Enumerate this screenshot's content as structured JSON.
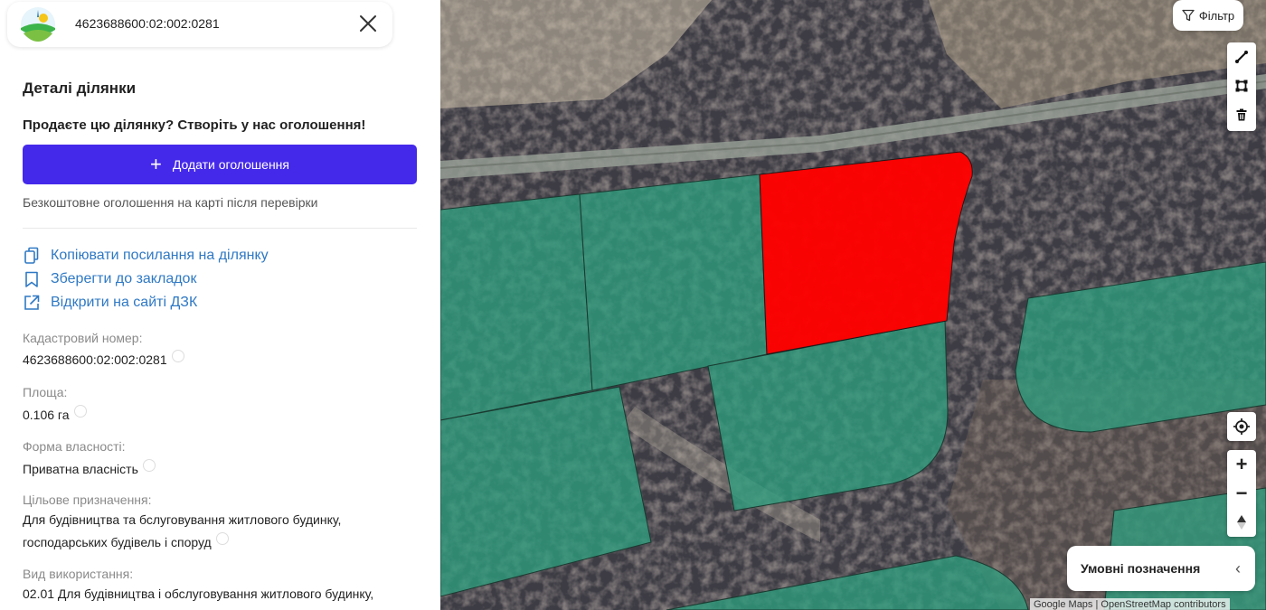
{
  "header": {
    "cadastral_title": "4623688600:02:002:0281",
    "close_icon": "close-icon",
    "logo_icon": "app-logo-icon"
  },
  "details": {
    "section_title": "Деталі ділянки",
    "promo_text": "Продаєте цю ділянку? Створіть у нас оголошення!",
    "add_button_label": "Додати оголошення",
    "add_button_color": "#4529ea",
    "free_note": "Безкоштовне оголошення на карті після перевірки"
  },
  "links": [
    {
      "label": "Копіювати посилання на ділянку",
      "icon": "copy-icon"
    },
    {
      "label": "Зберегти до закладок",
      "icon": "bookmark-icon"
    },
    {
      "label": "Відкрити на сайті ДЗК",
      "icon": "external-link-icon"
    }
  ],
  "fields": [
    {
      "label": "Кадастровий номер:",
      "value": "4623688600:02:002:0281"
    },
    {
      "label": "Площа:",
      "value": "0.106 га"
    },
    {
      "label": "Форма власності:",
      "value": "Приватна власність"
    },
    {
      "label": "Цільове призначення:",
      "value_line1": "Для будівництва та бслуговування житлового будинку,",
      "value_line2": "господарських будівель і споруд"
    },
    {
      "label": "Вид використання:",
      "value": "02.01 Для будівництва і обслуговування житлового будинку,"
    }
  ],
  "map": {
    "filter_label": "Фільтр",
    "legend_label": "Умовні позначення",
    "attribution": "Google Maps | OpenStreetMap contributors",
    "selected_parcel_color": "#ff0000",
    "parcel_color": "#2e9e7e",
    "tools": [
      "draw-line-icon",
      "draw-polygon-icon",
      "trash-icon"
    ],
    "controls": [
      "locate-icon",
      "zoom-in-icon",
      "zoom-out-icon",
      "compass-icon"
    ]
  }
}
